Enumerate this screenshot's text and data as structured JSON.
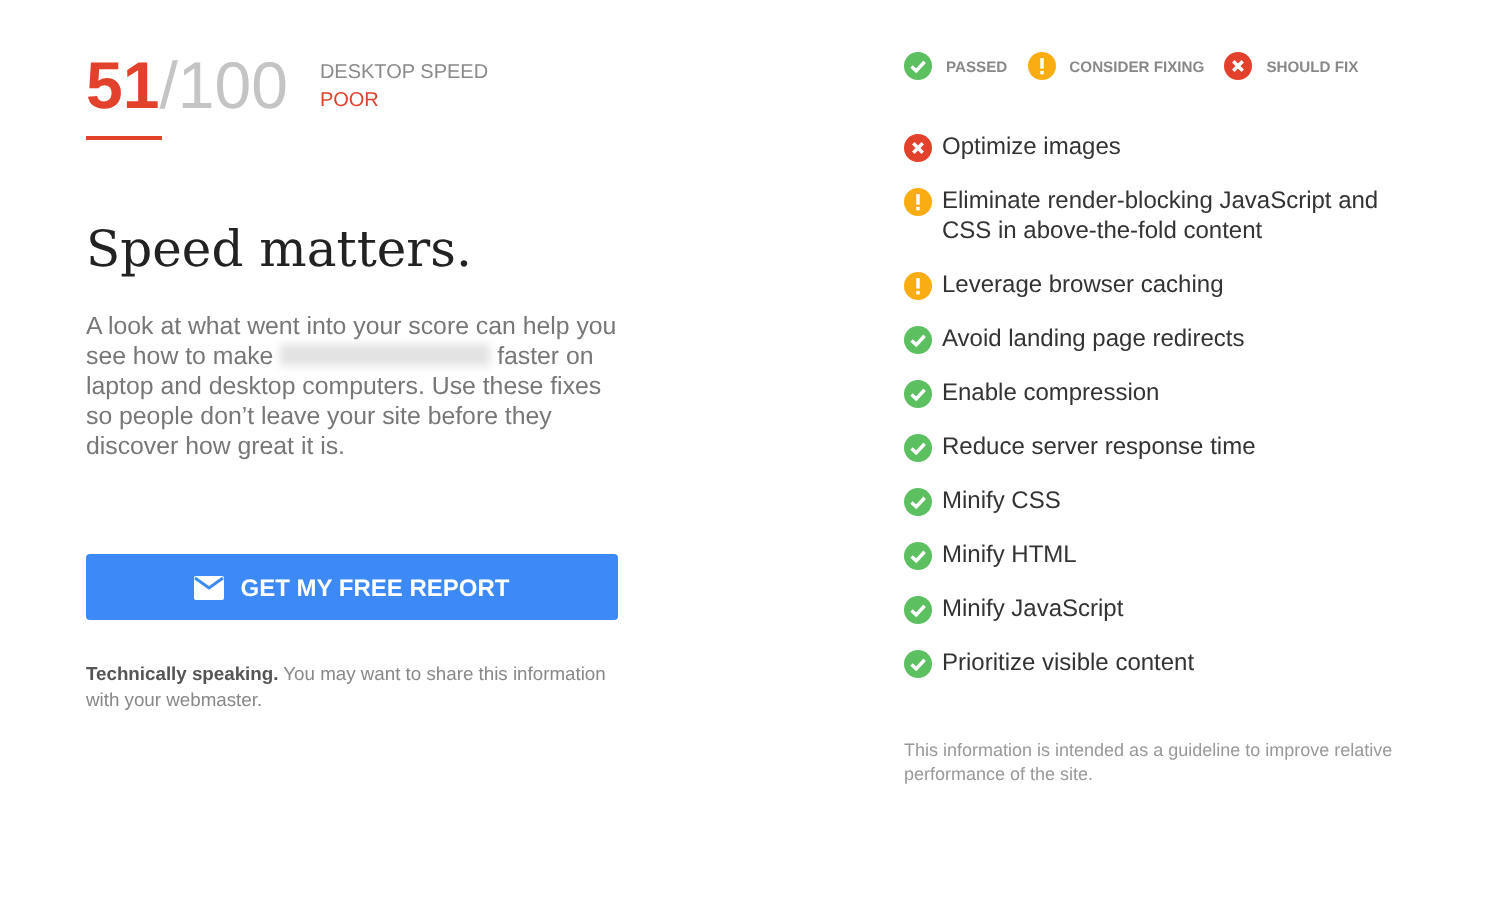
{
  "score": {
    "value": "51",
    "max": "/100",
    "label": "DESKTOP SPEED",
    "rating": "POOR"
  },
  "heading": "Speed matters.",
  "intro": {
    "before": "A look at what went into your score can help you see how to make",
    "after": "faster on laptop and desktop computers. Use these fixes so people don’t leave your site before they discover how great it is."
  },
  "report_button": "GET MY FREE REPORT",
  "note": "**Technically speaking.** You may want to share this information with your webmaster.",
  "legend": [
    {
      "kind": "passed",
      "label": "PASSED"
    },
    {
      "kind": "consider",
      "label": "CONSIDER FIXING"
    },
    {
      "kind": "fix",
      "label": "SHOULD FIX"
    }
  ],
  "rules": [
    {
      "kind": "fix",
      "label": "Optimize images"
    },
    {
      "kind": "consider",
      "label": "Eliminate render-blocking JavaScript and CSS in above-the-fold content"
    },
    {
      "kind": "consider",
      "label": "Leverage browser caching"
    },
    {
      "kind": "passed",
      "label": "Avoid landing page redirects"
    },
    {
      "kind": "passed",
      "label": "Enable compression"
    },
    {
      "kind": "passed",
      "label": "Reduce server response time"
    },
    {
      "kind": "passed",
      "label": "Minify CSS"
    },
    {
      "kind": "passed",
      "label": "Minify HTML"
    },
    {
      "kind": "passed",
      "label": "Minify JavaScript"
    },
    {
      "kind": "passed",
      "label": "Prioritize visible content"
    }
  ],
  "disclaimer": "This information is intended as a guideline to improve relative performance of the site."
}
